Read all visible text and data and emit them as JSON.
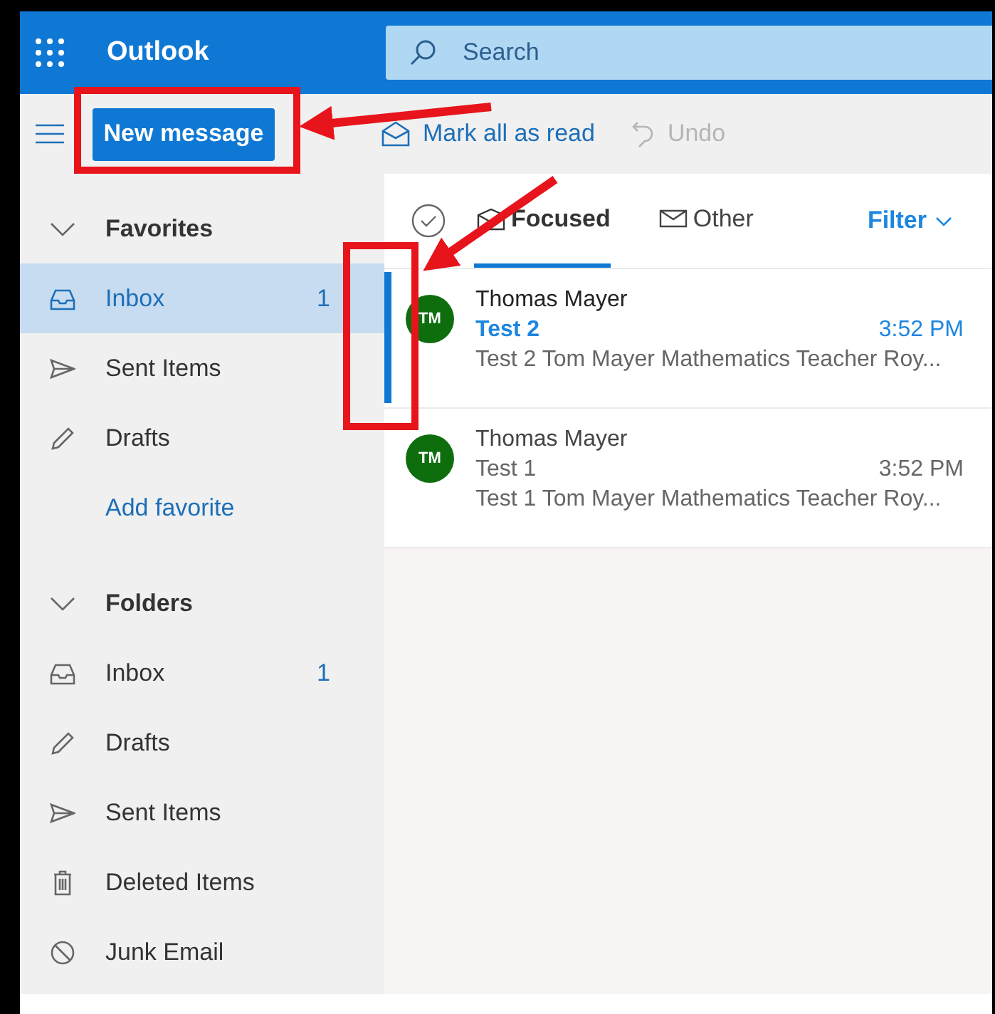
{
  "header": {
    "app_title": "Outlook",
    "search": {
      "placeholder": "Search"
    }
  },
  "toolbar": {
    "new_message": "New message",
    "actions": [
      {
        "kind": "mark-read",
        "label": "Mark all as read",
        "disabled": false
      },
      {
        "kind": "undo",
        "label": "Undo",
        "disabled": true
      }
    ]
  },
  "sidebar": {
    "sections": [
      {
        "title": "Favorites",
        "expanded": true,
        "items": [
          {
            "kind": "inbox",
            "label": "Inbox",
            "count": "1",
            "selected": true
          },
          {
            "kind": "sent",
            "label": "Sent Items",
            "selected": false
          },
          {
            "kind": "drafts",
            "label": "Drafts",
            "selected": false
          }
        ],
        "link": "Add favorite"
      },
      {
        "title": "Folders",
        "expanded": true,
        "items": [
          {
            "kind": "inbox",
            "label": "Inbox",
            "count": "1",
            "selected": false
          },
          {
            "kind": "drafts",
            "label": "Drafts",
            "selected": false
          },
          {
            "kind": "sent",
            "label": "Sent Items",
            "selected": false
          },
          {
            "kind": "deleted",
            "label": "Deleted Items",
            "selected": false
          },
          {
            "kind": "junk",
            "label": "Junk Email",
            "selected": false
          }
        ]
      }
    ]
  },
  "message_list": {
    "tabs": [
      {
        "kind": "focused",
        "label": "Focused",
        "selected": true
      },
      {
        "kind": "other",
        "label": "Other",
        "selected": false
      }
    ],
    "filter": "Filter",
    "messages": [
      {
        "initials": "TM",
        "sender": "Thomas Mayer",
        "subject": "Test 2",
        "time": "3:52 PM",
        "preview": "Test 2 Tom Mayer Mathematics Teacher Roy...",
        "unread": true
      },
      {
        "initials": "TM",
        "sender": "Thomas Mayer",
        "subject": "Test 1",
        "time": "3:52 PM",
        "preview": "Test 1 Tom Mayer Mathematics Teacher Roy...",
        "unread": false
      }
    ]
  },
  "annotations": [
    {
      "kind": "box"
    },
    {
      "kind": "arrow"
    },
    {
      "kind": "arrow"
    },
    {
      "kind": "box"
    }
  ]
}
